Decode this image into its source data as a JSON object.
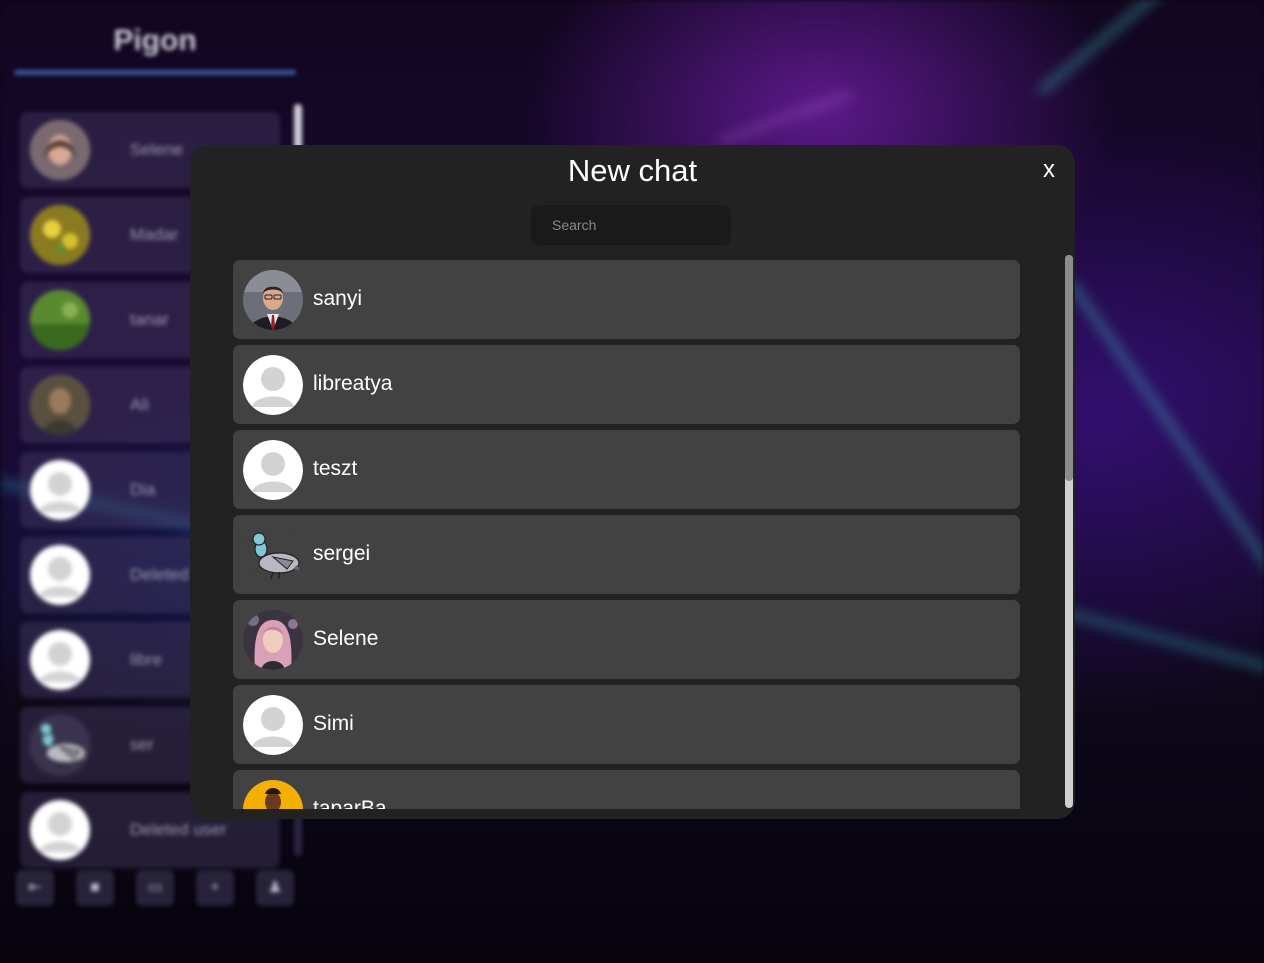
{
  "app": {
    "title": "Pigon"
  },
  "sidebar": {
    "chats": [
      {
        "name": "Selene",
        "avatar": "photo-woman"
      },
      {
        "name": "Madar",
        "avatar": "photo-flowers"
      },
      {
        "name": "tanar",
        "avatar": "photo-grass"
      },
      {
        "name": "Ali",
        "avatar": "photo-man"
      },
      {
        "name": "Dia",
        "avatar": "default-user-icon"
      },
      {
        "name": "Deleted",
        "avatar": "default-user-icon"
      },
      {
        "name": "libre",
        "avatar": "default-user-icon"
      },
      {
        "name": "ser",
        "avatar": "pigeon-icon"
      },
      {
        "name": "Deleted user",
        "avatar": "default-user-icon"
      }
    ],
    "toolbar": [
      {
        "icon": "logout-icon",
        "glyph": "⇤"
      },
      {
        "icon": "settings-icon",
        "glyph": "■"
      },
      {
        "icon": "new-chat-icon",
        "glyph": "▭"
      },
      {
        "icon": "add-icon",
        "glyph": "+"
      },
      {
        "icon": "profile-icon",
        "glyph": "♟"
      }
    ]
  },
  "modal": {
    "title": "New chat",
    "close_label": "x",
    "search": {
      "placeholder": "Search",
      "value": ""
    },
    "users": [
      {
        "name": "sanyi",
        "avatar": "photo-man-suit"
      },
      {
        "name": "libreatya",
        "avatar": "default-user-icon"
      },
      {
        "name": "teszt",
        "avatar": "default-user-icon"
      },
      {
        "name": "sergei",
        "avatar": "pigeon-icon"
      },
      {
        "name": "Selene",
        "avatar": "photo-woman-pink-hair"
      },
      {
        "name": "Simi",
        "avatar": "default-user-icon"
      },
      {
        "name": "taparBa",
        "avatar": "photo-person-yellow"
      }
    ]
  },
  "colors": {
    "modal_bg": "#222222",
    "item_bg": "#424242",
    "search_bg": "#1a1a1a",
    "text": "#ffffff",
    "default_avatar_bg": "#ffffff",
    "default_avatar_fg": "#d3d3d3"
  }
}
